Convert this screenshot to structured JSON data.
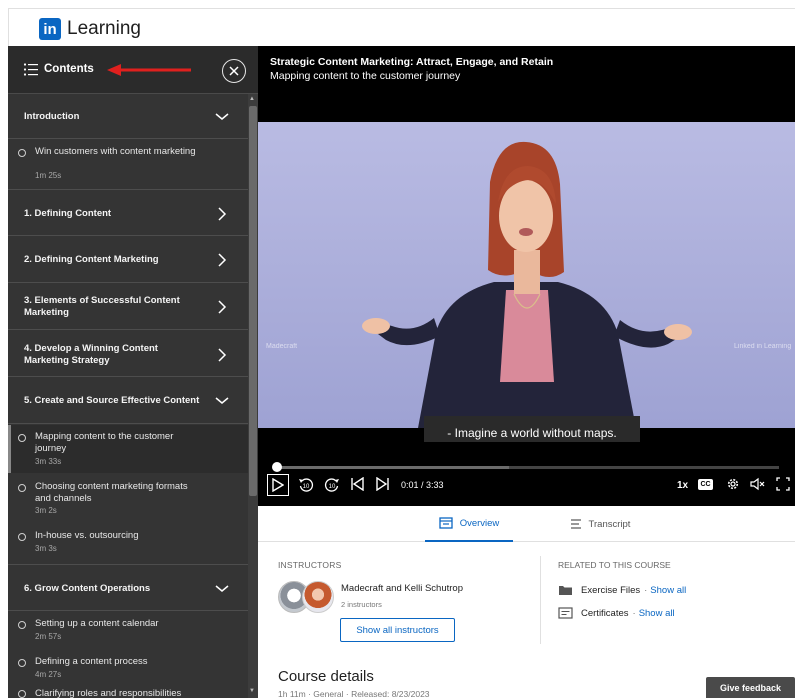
{
  "header": {
    "logo_mark": "in",
    "brand": "Learning"
  },
  "sidebar": {
    "title": "Contents",
    "chapters": [
      {
        "title": "Introduction",
        "expanded": true
      },
      {
        "title": "1. Defining Content",
        "expanded": false
      },
      {
        "title": "2. Defining Content Marketing",
        "expanded": false
      },
      {
        "title": "3. Elements of Successful Content Marketing",
        "expanded": false
      },
      {
        "title": "4. Develop a Winning Content Marketing Strategy",
        "expanded": false
      },
      {
        "title": "5. Create and Source Effective Content",
        "expanded": true
      },
      {
        "title": "6. Grow Content Operations",
        "expanded": true
      }
    ],
    "lessons": [
      {
        "title": "Win customers with content marketing",
        "duration": "1m 25s"
      },
      {
        "title": "Mapping content to the customer journey",
        "duration": "3m 33s"
      },
      {
        "title": "Choosing content marketing formats and channels",
        "duration": "3m 2s"
      },
      {
        "title": "In-house vs. outsourcing",
        "duration": "3m 3s"
      },
      {
        "title": "Setting up a content calendar",
        "duration": "2m 57s"
      },
      {
        "title": "Defining a content process",
        "duration": "4m 27s"
      },
      {
        "title": "Clarifying roles and responsibilities",
        "duration": ""
      }
    ]
  },
  "player": {
    "course_title": "Strategic Content Marketing: Attract, Engage, and Retain",
    "video_title": "Mapping content to the customer journey",
    "caption": "- Imagine a world without maps.",
    "watermark_left": "Madecraft",
    "watermark_right": "Linked in Learning",
    "time": "0:01 / 3:33",
    "speed": "1x",
    "cc_label": "CC",
    "skip_back_label": "10",
    "skip_forward_label": "10",
    "progress_fraction": 0.005
  },
  "tabs": [
    {
      "label": "Overview",
      "active": true
    },
    {
      "label": "Transcript",
      "active": false
    }
  ],
  "overview": {
    "instructors_heading": "INSTRUCTORS",
    "instructor_names": "Madecraft and Kelli Schutrop",
    "instructor_count": "2 instructors",
    "show_all_instructors": "Show all instructors",
    "related_heading": "RELATED TO THIS COURSE",
    "related": [
      {
        "label": "Exercise Files",
        "link": "Show all"
      },
      {
        "label": "Certificates",
        "link": "Show all"
      }
    ],
    "separator": "·",
    "details_heading": "Course details",
    "details_meta": "1h 11m  ·  General  ·  Released: 8/23/2023"
  },
  "feedback_label": "Give feedback",
  "colors": {
    "accent": "#0a66c2",
    "sidebar_bg": "#343434",
    "annotation_arrow": "#e0201e"
  }
}
